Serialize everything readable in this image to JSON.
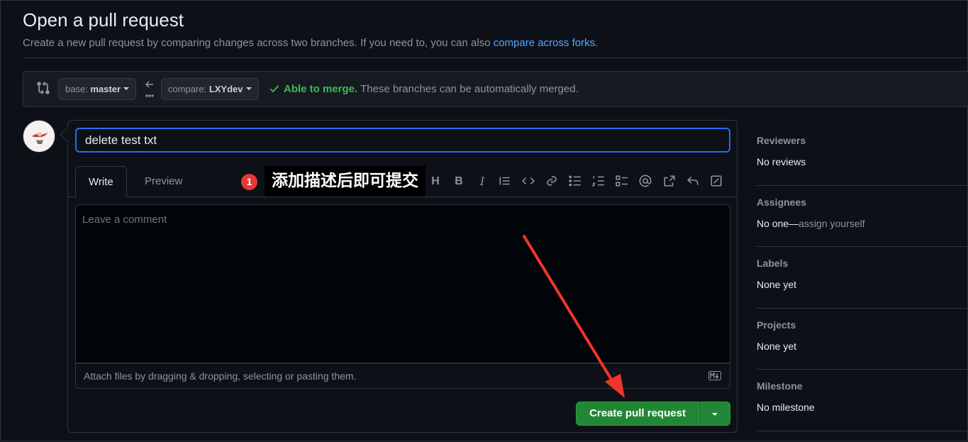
{
  "page": {
    "title": "Open a pull request",
    "subtitle_prefix": "Create a new pull request by comparing changes across two branches. If you need to, you can also ",
    "subtitle_link": "compare across forks",
    "subtitle_suffix": "."
  },
  "compare": {
    "base_label": "base: ",
    "base_branch": "master",
    "compare_label": "compare: ",
    "compare_branch": "LXYdev",
    "merge_ok": "Able to merge.",
    "merge_text": " These branches can be automatically merged."
  },
  "editor": {
    "title_value": "delete test txt",
    "tabs": [
      {
        "label": "Write",
        "active": true
      },
      {
        "label": "Preview",
        "active": false
      }
    ],
    "comment_placeholder": "Leave a comment",
    "attach_text": "Attach files by dragging & dropping, selecting or pasting them.",
    "toolbar": [
      "heading-icon",
      "bold-icon",
      "italic-icon",
      "quote-icon",
      "code-icon",
      "link-icon",
      "unordered-list-icon",
      "ordered-list-icon",
      "task-list-icon",
      "mention-icon",
      "reference-icon",
      "reply-icon",
      "saved-reply-icon"
    ],
    "toolbar_labels": {
      "heading": "H",
      "bold": "B",
      "italic": "I"
    },
    "create_button": "Create pull request"
  },
  "sidebar": [
    {
      "heading": "Reviewers",
      "value": "No reviews"
    },
    {
      "heading": "Assignees",
      "value": "No one—",
      "muted": "assign yourself"
    },
    {
      "heading": "Labels",
      "value": "None yet"
    },
    {
      "heading": "Projects",
      "value": "None yet"
    },
    {
      "heading": "Milestone",
      "value": "No milestone"
    }
  ],
  "annotation": {
    "badge": "1",
    "text": "添加描述后即可提交",
    "arrow_color": "#f0352a"
  },
  "colors": {
    "accent_blue": "#58a6ff",
    "success_green": "#3fb950",
    "button_green": "#238636",
    "background": "#0d1117"
  }
}
